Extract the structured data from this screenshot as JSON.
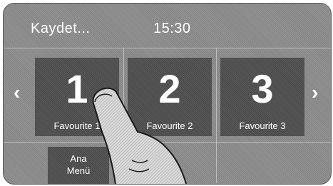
{
  "status_bar": {
    "title": "Kaydet...",
    "time": "15:30"
  },
  "favourites": [
    {
      "number": "1",
      "label": "Favourite 1"
    },
    {
      "number": "2",
      "label": "Favourite 2"
    },
    {
      "number": "3",
      "label": "Favourite 3"
    }
  ],
  "main_menu": {
    "line1": "Ana",
    "line2": "Menü"
  },
  "navigation": {
    "prev_icon": "chevron-left-icon",
    "next_icon": "chevron-right-icon"
  },
  "colors": {
    "background": "#8a8a8a",
    "tile": "#4f4f4f",
    "text": "#ffffff"
  }
}
